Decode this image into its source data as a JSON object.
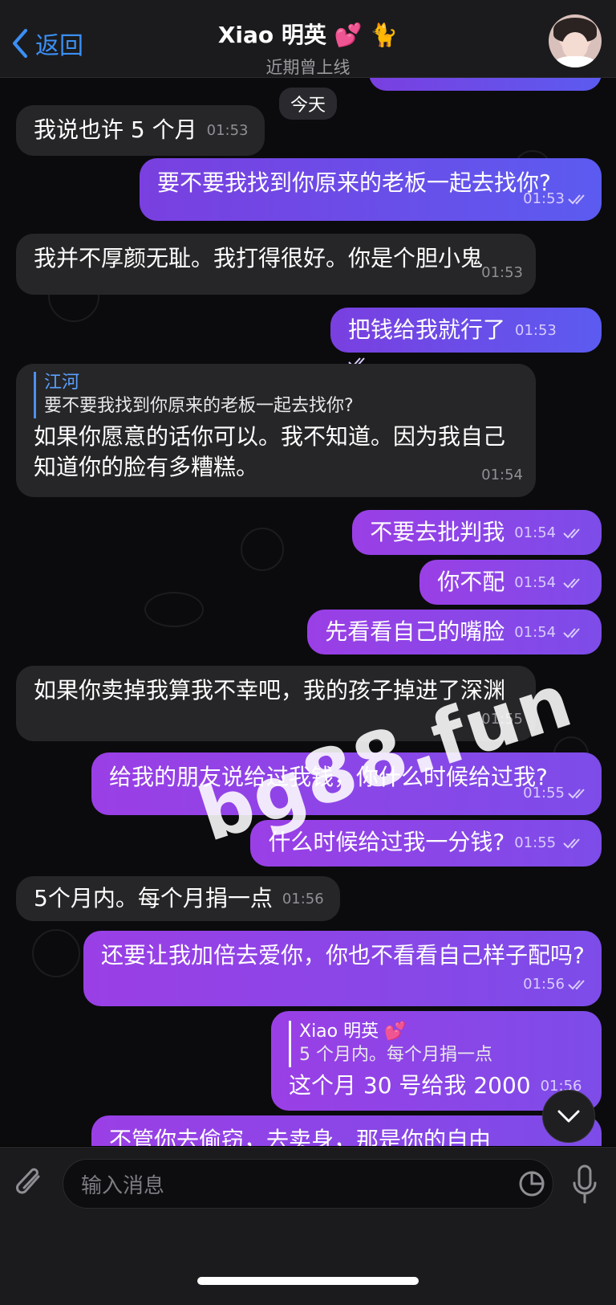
{
  "header": {
    "back_label": "返回",
    "title": "Xiao 明英 💕 🐈",
    "status": "近期曾上线"
  },
  "chat": {
    "date_pill": "今天",
    "messages": [
      {
        "dir": "in",
        "text": "我说也许 5 个月",
        "time": "01:53"
      },
      {
        "dir": "out",
        "text": "要不要我找到你原来的老板一起去找你?",
        "time": "01:53"
      },
      {
        "dir": "in",
        "text": "我并不厚颜无耻。我打得很好。你是个胆小鬼",
        "time": "01:53"
      },
      {
        "dir": "out",
        "text": "把钱给我就行了",
        "time": "01:53"
      },
      {
        "dir": "in",
        "reply_name": "江河",
        "reply_text": "要不要我找到你原来的老板一起去找你?",
        "text": "如果你愿意的话你可以。我不知道。因为我自己知道你的脸有多糟糕。",
        "time": "01:54"
      },
      {
        "dir": "out",
        "text": "不要去批判我",
        "time": "01:54"
      },
      {
        "dir": "out",
        "text": "你不配",
        "time": "01:54"
      },
      {
        "dir": "out",
        "text": "先看看自己的嘴脸",
        "time": "01:54"
      },
      {
        "dir": "in",
        "text": "如果你卖掉我算我不幸吧，我的孩子掉进了深渊",
        "time": "01:55"
      },
      {
        "dir": "out",
        "text": "给我的朋友说给过我钱，你什么时候给过我?",
        "time": "01:55"
      },
      {
        "dir": "out",
        "text": "什么时候给过我一分钱?",
        "time": "01:55"
      },
      {
        "dir": "in",
        "text": "5个月内。每个月捐一点",
        "time": "01:56"
      },
      {
        "dir": "out",
        "text": "还要让我加倍去爱你，你也不看看自己样子配吗?",
        "time": "01:56"
      },
      {
        "dir": "out",
        "reply_name": "Xiao 明英 💕",
        "reply_text": "5 个月内。每个月捐一点",
        "text": "这个月 30 号给我 2000",
        "time": "01:56"
      },
      {
        "dir": "out",
        "text": "不管你去偷窃，去卖身，那是你的自由",
        "time": ""
      }
    ]
  },
  "watermark": "bg88.fun",
  "composer": {
    "placeholder": "输入消息"
  },
  "colors": {
    "accent": "#3b8ff5",
    "incoming_bubble": "#262628",
    "outgoing_bubble": "#7d4ce8",
    "background": "#0b0b0d"
  },
  "icons": [
    "chevron-left-icon",
    "paperclip-icon",
    "sticker-icon",
    "microphone-icon",
    "chevron-down-icon",
    "double-check-icon"
  ]
}
